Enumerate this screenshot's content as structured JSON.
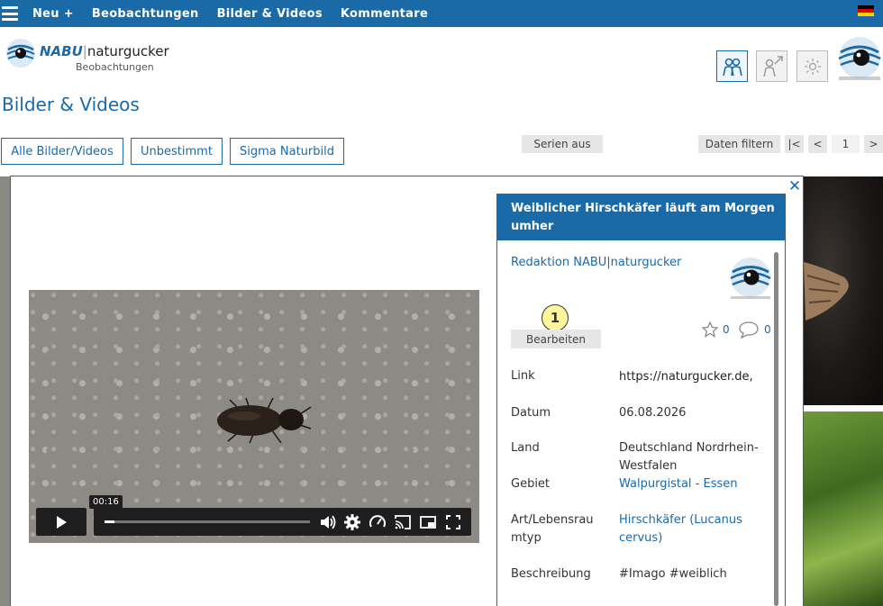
{
  "nav": {
    "items": [
      "Neu +",
      "Beobachtungen",
      "Bilder & Videos",
      "Kommentare"
    ],
    "language_flag": "de-flag"
  },
  "logo": {
    "brand": "NABU",
    "name": "naturgucker",
    "subtitle": "Beobachtungen"
  },
  "page": {
    "title": "Bilder & Videos"
  },
  "filters": {
    "buttons": [
      "Alle Bilder/Videos",
      "Unbestimmt",
      "Sigma Naturbild"
    ],
    "series": "Serien aus",
    "data_filter": "Daten filtern",
    "first": "|<",
    "prev": "<",
    "page": "1",
    "next": ">"
  },
  "video": {
    "time": "00:16",
    "progress": 0.05
  },
  "detail": {
    "title": "Weiblicher Hirschkäfer läuft am Morgen umher",
    "author": "Redaktion NABU|naturgucker",
    "badge": "1",
    "edit": "Bearbeiten",
    "likes": "0",
    "comments": "0",
    "fields": [
      {
        "label": "Link",
        "value": "https://naturgucker.de,"
      },
      {
        "label": "Datum",
        "value": "06.08.2026"
      },
      {
        "label": "Land",
        "value": "Deutschland Nordrhein-Westfalen"
      },
      {
        "label": "Gebiet",
        "value": "Walpurgistal - Essen"
      },
      {
        "label": "Art/Lebensraumtyp",
        "value": "Hirschkäfer (Lucanus cervus)"
      },
      {
        "label": "Beschreibung",
        "value": "#Imago #weiblich"
      }
    ]
  },
  "colors": {
    "brand": "#1a6aa8",
    "badge": "#fff59d"
  }
}
